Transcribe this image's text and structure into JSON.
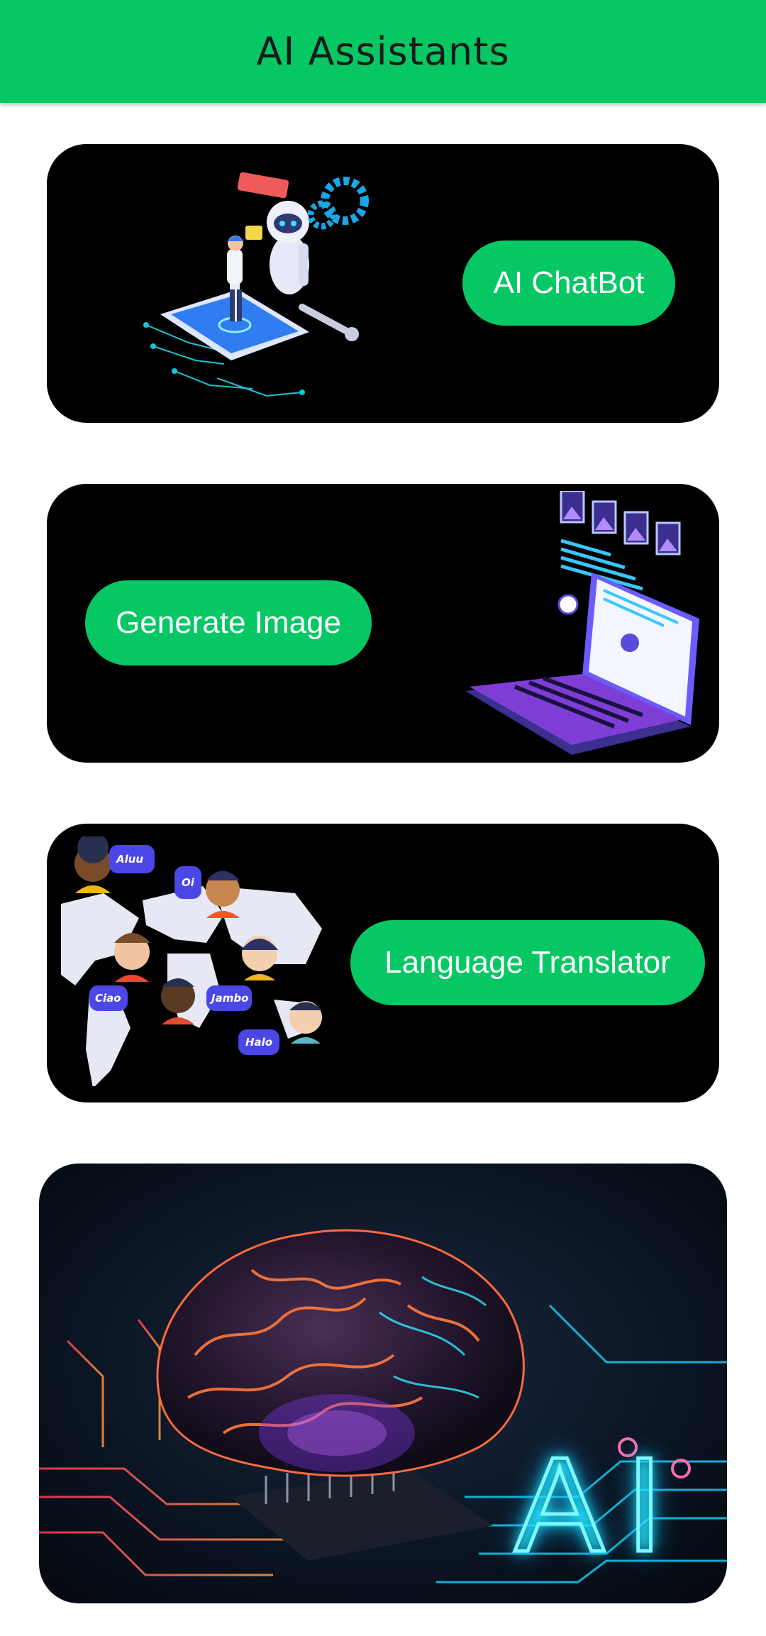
{
  "appbar": {
    "title": "AI Assistants"
  },
  "cards": {
    "chatbot": {
      "button_label": "AI ChatBot",
      "art": "robot-assistant-illustration"
    },
    "image": {
      "button_label": "Generate Image",
      "art": "laptop-image-generation-illustration"
    },
    "translator": {
      "button_label": "Language Translator",
      "art": "world-map-languages-illustration",
      "bubbles": [
        "Aluu",
        "Oi",
        "Ciao",
        "Jambo",
        "Halo"
      ]
    }
  },
  "hero": {
    "label": "AI",
    "art": "glowing-brain-circuit-illustration"
  },
  "colors": {
    "accent": "#07c765",
    "card": "#000000",
    "neon": "#22e8ff"
  }
}
